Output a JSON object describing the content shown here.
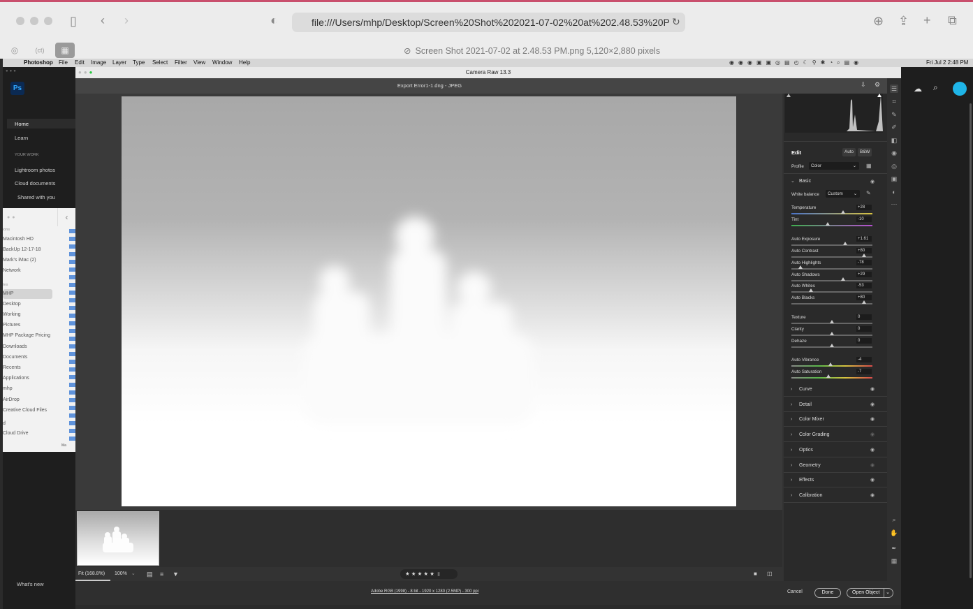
{
  "safari": {
    "url": "file:///Users/mhp/Desktop/Screen%20Shot%202021-07-02%20at%202.48.53%20P",
    "page_title": "Screen Shot 2021-07-02 at 2.48.53 PM.png 5,120×2,880 pixels",
    "tab_icon_2": "(ct)"
  },
  "menubar": {
    "app": "Photoshop",
    "items": [
      "File",
      "Edit",
      "Image",
      "Layer",
      "Type",
      "Select",
      "Filter",
      "View",
      "Window",
      "Help"
    ],
    "clock": "Fri Jul 2  2:48 PM"
  },
  "ps_home": {
    "logo": "Ps",
    "nav": [
      "Home",
      "Learn"
    ],
    "section": "YOUR WORK",
    "work_items": [
      "Lightroom photos",
      "Cloud documents",
      "Shared with you"
    ],
    "whats_new": "What's new"
  },
  "finder": {
    "items": [
      "ions",
      "Macintosh HD",
      "BackUp 12-17-18",
      "Mark's iMac (2)",
      "Network",
      "tes",
      "MHP",
      "Desktop",
      "Working",
      "Pictures",
      "MHP Package Pricing",
      "Downloads",
      "Documents",
      "Recents",
      "Applications",
      "mhp",
      "AirDrop",
      "Creative Cloud Files",
      "d",
      "Cloud Drive"
    ],
    "selected": "MHP",
    "status": "Ma"
  },
  "camera_raw": {
    "window_title": "Camera Raw 13.3",
    "file_name": "Export Error1-1.dng",
    "file_sep": "-",
    "file_type": "JPEG",
    "bottom": {
      "fit_label": "Fit (168.8%)",
      "zoom": "100%",
      "stars": "★ ★ ★ ★ ★"
    },
    "footer": {
      "workflow": "Adobe RGB (1998) - 8 bit - 1920 x 1280 (2.5MP) - 300 ppi",
      "cancel": "Cancel",
      "done": "Done",
      "open": "Open Object"
    },
    "edit": {
      "title": "Edit",
      "auto": "Auto",
      "bw": "B&W",
      "profile_label": "Profile",
      "profile_value": "Color",
      "basic_label": "Basic",
      "wb_label": "White balance",
      "wb_value": "Custom",
      "sliders": [
        {
          "label": "Temperature",
          "value": "+28",
          "pos": 0.64
        },
        {
          "label": "Tint",
          "value": "-10",
          "pos": 0.45
        },
        {
          "label": "Auto Exposure",
          "value": "+1.61",
          "pos": 0.66
        },
        {
          "label": "Auto Contrast",
          "value": "+80",
          "pos": 0.9
        },
        {
          "label": "Auto Highlights",
          "value": "-78",
          "pos": 0.11
        },
        {
          "label": "Auto Shadows",
          "value": "+29",
          "pos": 0.64
        },
        {
          "label": "Auto Whites",
          "value": "-53",
          "pos": 0.24
        },
        {
          "label": "Auto Blacks",
          "value": "+80",
          "pos": 0.9
        },
        {
          "label": "Texture",
          "value": "0",
          "pos": 0.5
        },
        {
          "label": "Clarity",
          "value": "0",
          "pos": 0.5
        },
        {
          "label": "Dehaze",
          "value": "0",
          "pos": 0.5
        },
        {
          "label": "Auto Vibrance",
          "value": "-4",
          "pos": 0.48
        },
        {
          "label": "Auto Saturation",
          "value": "-7",
          "pos": 0.46
        }
      ],
      "sections": [
        "Curve",
        "Detail",
        "Color Mixer",
        "Color Grading",
        "Optics",
        "Geometry",
        "Effects",
        "Calibration"
      ]
    }
  }
}
